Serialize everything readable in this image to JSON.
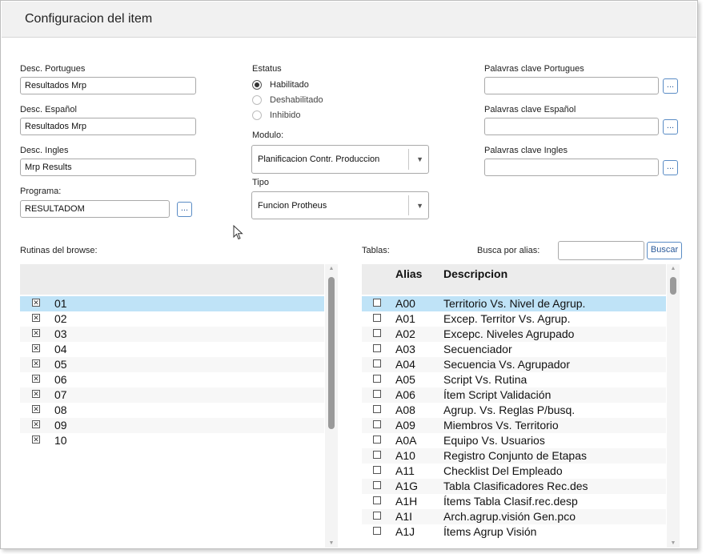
{
  "window": {
    "title": "Configuracion del item"
  },
  "form": {
    "desc_portugues": {
      "label": "Desc. Portugues",
      "value": "Resultados Mrp"
    },
    "desc_espanol": {
      "label": "Desc. Español",
      "value": "Resultados Mrp"
    },
    "desc_ingles": {
      "label": "Desc. Ingles",
      "value": "Mrp Results"
    },
    "programa": {
      "label": "Programa:",
      "value": "RESULTADOM",
      "button": "..."
    },
    "estatus": {
      "label": "Estatus",
      "options": [
        {
          "label": "Habilitado",
          "selected": true
        },
        {
          "label": "Deshabilitado",
          "selected": false
        },
        {
          "label": "Inhibido",
          "selected": false
        }
      ]
    },
    "modulo": {
      "label": "Modulo:",
      "value": "Planificacion Contr. Produccion"
    },
    "tipo": {
      "label": "Tipo",
      "value": "Funcion Protheus"
    },
    "palavras_portugues": {
      "label": "Palavras clave Portugues",
      "value": "",
      "button": "..."
    },
    "palavras_espanol": {
      "label": "Palavras clave Español",
      "value": "",
      "button": "..."
    },
    "palavras_ingles": {
      "label": "Palavras clave Ingles",
      "value": "",
      "button": "..."
    }
  },
  "rutinas": {
    "label": "Rutinas del browse:",
    "rows": [
      {
        "value": "01",
        "checked": true,
        "selected": true
      },
      {
        "value": "02",
        "checked": true
      },
      {
        "value": "03",
        "checked": true
      },
      {
        "value": "04",
        "checked": true
      },
      {
        "value": "05",
        "checked": true
      },
      {
        "value": "06",
        "checked": true
      },
      {
        "value": "07",
        "checked": true
      },
      {
        "value": "08",
        "checked": true
      },
      {
        "value": "09",
        "checked": true
      },
      {
        "value": "10",
        "checked": true
      }
    ]
  },
  "tablas": {
    "label": "Tablas:",
    "search_label": "Busca por alias:",
    "search_value": "",
    "search_button": "Buscar",
    "columns": [
      "Alias",
      "Descripcion"
    ],
    "rows": [
      {
        "alias": "A00",
        "desc": "Territorio Vs. Nivel de Agrup.",
        "selected": true
      },
      {
        "alias": "A01",
        "desc": "Excep. Territor Vs. Agrup."
      },
      {
        "alias": "A02",
        "desc": "Excepc. Niveles Agrupado"
      },
      {
        "alias": "A03",
        "desc": "Secuenciador"
      },
      {
        "alias": "A04",
        "desc": "Secuencia Vs. Agrupador"
      },
      {
        "alias": "A05",
        "desc": "Script Vs. Rutina"
      },
      {
        "alias": "A06",
        "desc": "Ítem Script Validación"
      },
      {
        "alias": "A08",
        "desc": "Agrup. Vs. Reglas P/busq."
      },
      {
        "alias": "A09",
        "desc": "Miembros Vs. Territorio"
      },
      {
        "alias": "A0A",
        "desc": "Equipo Vs. Usuarios"
      },
      {
        "alias": "A10",
        "desc": "Registro Conjunto de Etapas"
      },
      {
        "alias": "A11",
        "desc": "Checklist Del Empleado"
      },
      {
        "alias": "A1G",
        "desc": "Tabla Clasificadores Rec.des"
      },
      {
        "alias": "A1H",
        "desc": "Ítems Tabla Clasif.rec.desp"
      },
      {
        "alias": "A1I",
        "desc": "Arch.agrup.visión Gen.pco"
      },
      {
        "alias": "A1J",
        "desc": "Ítems Agrup Visión"
      }
    ]
  },
  "colors": {
    "selected_row": "#bfe3f7",
    "accent": "#5a8cc5"
  }
}
